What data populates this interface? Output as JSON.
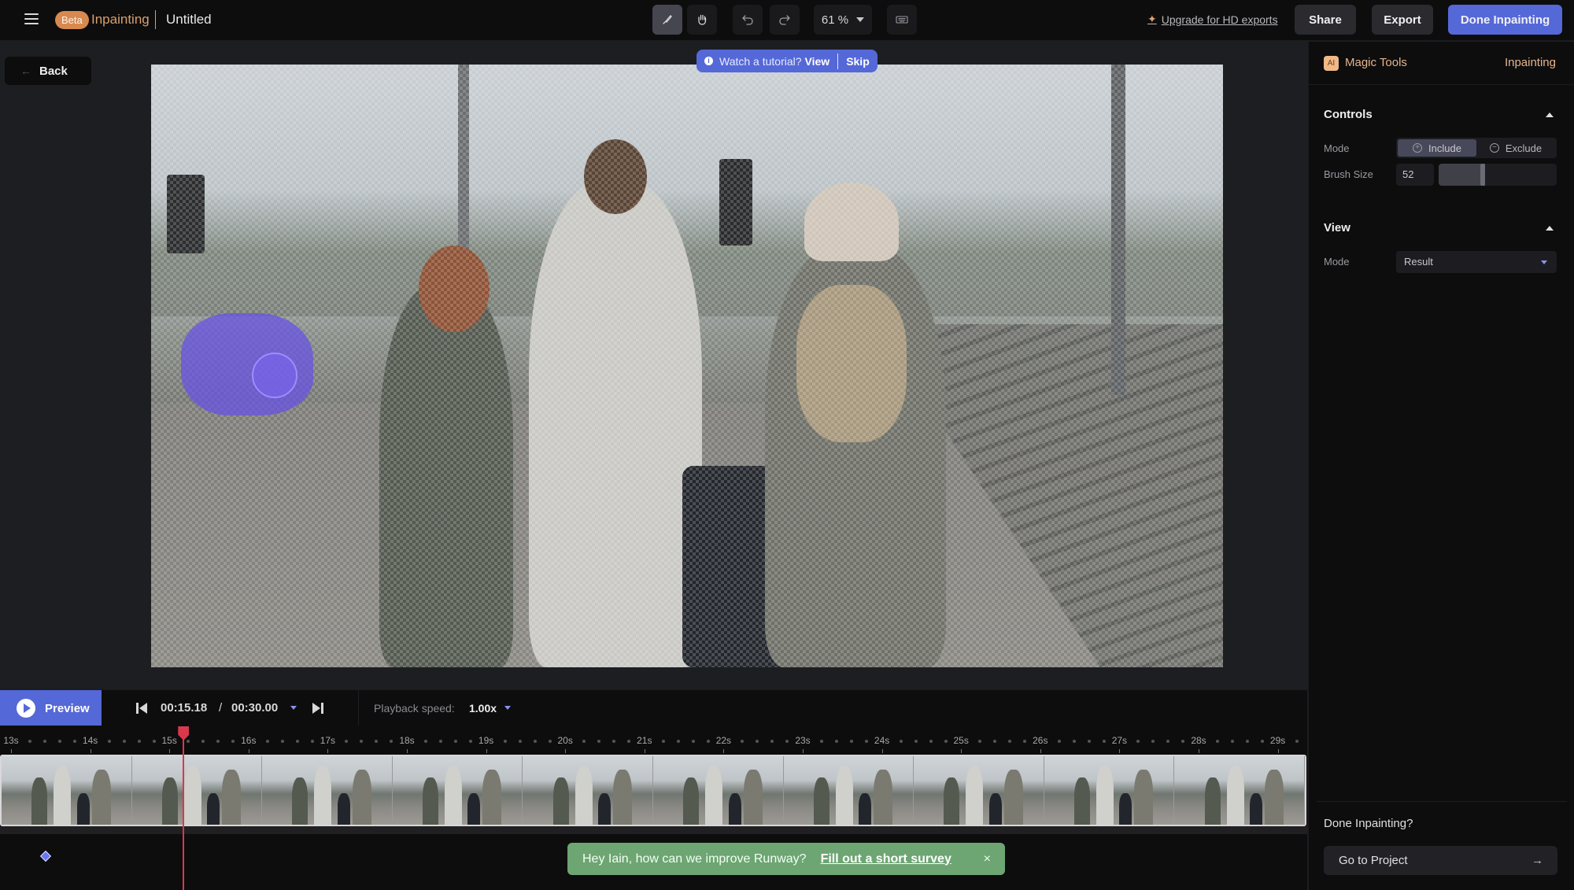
{
  "header": {
    "beta_badge": "Beta",
    "app_name": "Inpainting",
    "doc_title": "Untitled",
    "zoom_level": "61 %",
    "upgrade_link": "Upgrade for HD exports",
    "share_label": "Share",
    "export_label": "Export",
    "done_label": "Done Inpainting",
    "tools": [
      {
        "name": "brush-tool",
        "icon": "brush-icon",
        "active": true
      },
      {
        "name": "hand-tool",
        "icon": "hand-icon",
        "active": false
      },
      {
        "name": "undo",
        "icon": "undo-icon",
        "active": false
      },
      {
        "name": "redo",
        "icon": "redo-icon",
        "active": false
      },
      {
        "name": "keyboard-shortcuts",
        "icon": "keyboard-icon",
        "active": false
      }
    ]
  },
  "canvas": {
    "back_label": "Back",
    "tutorial": {
      "prompt": "Watch a tutorial?",
      "view_label": "View",
      "skip_label": "Skip"
    },
    "mask_color": "#6750e6"
  },
  "playback": {
    "preview_label": "Preview",
    "current_time": "00:15.18",
    "separator": "/",
    "total_time": "00:30.00",
    "speed_label": "Playback speed:",
    "speed_value": "1.00x"
  },
  "timeline": {
    "ticks": [
      "13s",
      "14s",
      "15s",
      "16s",
      "17s",
      "18s",
      "19s",
      "20s",
      "21s",
      "22s",
      "23s",
      "24s",
      "25s",
      "26s",
      "27s",
      "28s",
      "29s"
    ],
    "playhead_time_s": 15.18,
    "keyframe_count": 1,
    "thumbnail_count": 10
  },
  "toast": {
    "message": "Hey Iain, how can we improve Runway?",
    "link_label": "Fill out a short survey",
    "close_label": "×",
    "color": "#6da573"
  },
  "panel": {
    "ai_badge": "AI",
    "title": "Magic Tools",
    "mode": "Inpainting",
    "controls": {
      "heading": "Controls",
      "mode_label": "Mode",
      "include_label": "Include",
      "exclude_label": "Exclude",
      "selected_mode": "Include",
      "brush_size_label": "Brush Size",
      "brush_size_value": "52",
      "brush_size_fraction": 0.39
    },
    "view": {
      "heading": "View",
      "mode_label": "Mode",
      "mode_value": "Result"
    },
    "done_question": "Done Inpainting?",
    "go_to_project_label": "Go to Project"
  },
  "colors": {
    "accent": "#5568d8",
    "beta_orange": "#d8894f",
    "playhead": "#d8394c"
  }
}
